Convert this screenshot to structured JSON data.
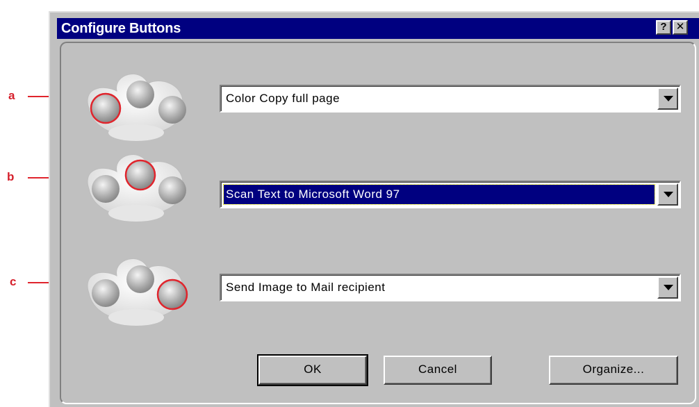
{
  "callouts": [
    {
      "label": "a"
    },
    {
      "label": "b"
    },
    {
      "label": "c"
    }
  ],
  "window": {
    "title": "Configure Buttons",
    "help_button": "?",
    "close_button": "✕"
  },
  "assignments": [
    {
      "value": "Color Copy full page",
      "selected": false
    },
    {
      "value": "Scan Text to Microsoft Word 97",
      "selected": true
    },
    {
      "value": "Send Image to Mail recipient",
      "selected": false
    }
  ],
  "buttons": {
    "ok": "OK",
    "cancel": "Cancel",
    "organize": "Organize..."
  },
  "colors": {
    "highlight_ring": "#e0242c",
    "titlebar": "#000080",
    "face": "#c0c0c0"
  },
  "icons": [
    "scanner-button-pad-icon",
    "dropdown-arrow-icon",
    "help-icon",
    "close-icon"
  ]
}
